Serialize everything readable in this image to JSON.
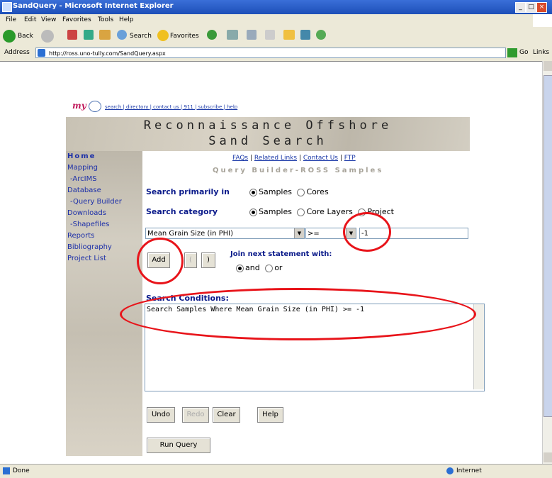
{
  "window": {
    "title": "SandQuery - Microsoft Internet Explorer"
  },
  "menu": [
    "File",
    "Edit",
    "View",
    "Favorites",
    "Tools",
    "Help"
  ],
  "toolbar": {
    "back": "Back",
    "search": "Search",
    "favorites": "Favorites"
  },
  "address": {
    "label": "Address",
    "url": "http://ross.uno-tully.com/SandQuery.aspx",
    "go": "Go",
    "links": "Links"
  },
  "header_links": "search | directory | contact us | 911 | subscribe | help",
  "banner": {
    "line1": "Reconnaissance Offshore",
    "line2": "Sand Search"
  },
  "sidebar": [
    "Home",
    "Mapping",
    "-ArcIMS",
    "Database",
    "-Query Builder",
    "Downloads",
    "-Shapefiles",
    "Reports",
    "Bibliography",
    "Project List"
  ],
  "top_links": {
    "faqs": "FAQs",
    "related": "Related Links",
    "contact": "Contact Us",
    "ftp": "FTP"
  },
  "subtitle": "Query Builder-ROSS Samples",
  "search_primarily": {
    "label": "Search primarily in",
    "opt1": "Samples",
    "opt2": "Cores"
  },
  "search_category": {
    "label": "Search category",
    "opt1": "Samples",
    "opt2": "Core Layers",
    "opt3": "Project"
  },
  "field_select": "Mean Grain Size (in PHI)",
  "operator_select": ">=",
  "value_input": "-1",
  "buttons": {
    "add": "Add",
    "open_paren": "(",
    "close_paren": ")",
    "undo": "Undo",
    "redo": "Redo",
    "clear": "Clear",
    "help": "Help",
    "run": "Run Query"
  },
  "join": {
    "label": "Join next statement with:",
    "and": "and",
    "or": "or"
  },
  "conditions": {
    "label": "Search Conditions:",
    "text": "Search Samples Where Mean Grain Size (in PHI) >= -1"
  },
  "status": {
    "left": "Done",
    "zone": "Internet"
  }
}
